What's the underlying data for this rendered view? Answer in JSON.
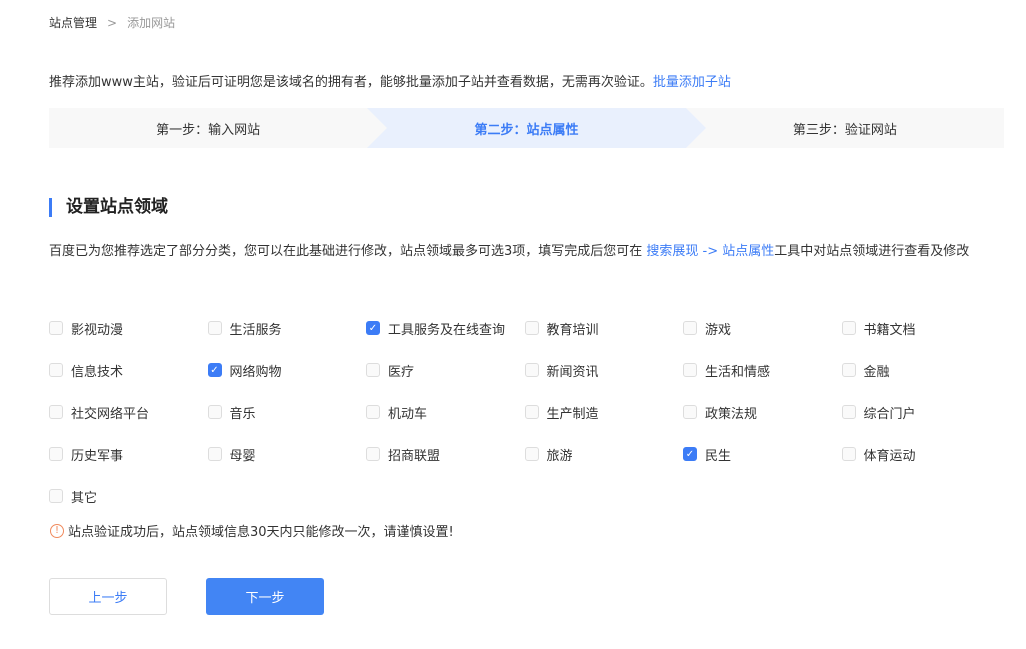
{
  "breadcrumb": {
    "parent": "站点管理",
    "separator": ">",
    "current": "添加网站"
  },
  "intro": {
    "text": "推荐添加www主站，验证后可证明您是该域名的拥有者，能够批量添加子站并查看数据，无需再次验证。",
    "link": "批量添加子站"
  },
  "steps": [
    "第一步：输入网站",
    "第二步：站点属性",
    "第三步：验证网站"
  ],
  "section": {
    "title": "设置站点领域",
    "desc_1": "百度已为您推荐选定了部分分类，您可以在此基础进行修改，站点领域最多可选3项，填写完成后您可在 ",
    "link_1": "搜索展现 -> 站点属性",
    "desc_2": "工具中对站点领域进行查看及修改"
  },
  "categories": [
    {
      "label": "影视动漫",
      "checked": false
    },
    {
      "label": "生活服务",
      "checked": false
    },
    {
      "label": "工具服务及在线查询",
      "checked": true
    },
    {
      "label": "教育培训",
      "checked": false
    },
    {
      "label": "游戏",
      "checked": false
    },
    {
      "label": "书籍文档",
      "checked": false
    },
    {
      "label": "信息技术",
      "checked": false
    },
    {
      "label": "网络购物",
      "checked": true
    },
    {
      "label": "医疗",
      "checked": false
    },
    {
      "label": "新闻资讯",
      "checked": false
    },
    {
      "label": "生活和情感",
      "checked": false
    },
    {
      "label": "金融",
      "checked": false
    },
    {
      "label": "社交网络平台",
      "checked": false
    },
    {
      "label": "音乐",
      "checked": false
    },
    {
      "label": "机动车",
      "checked": false
    },
    {
      "label": "生产制造",
      "checked": false
    },
    {
      "label": "政策法规",
      "checked": false
    },
    {
      "label": "综合门户",
      "checked": false
    },
    {
      "label": "历史军事",
      "checked": false
    },
    {
      "label": "母婴",
      "checked": false
    },
    {
      "label": "招商联盟",
      "checked": false
    },
    {
      "label": "旅游",
      "checked": false
    },
    {
      "label": "民生",
      "checked": true
    },
    {
      "label": "体育运动",
      "checked": false
    },
    {
      "label": "其它",
      "checked": false
    }
  ],
  "warning": "站点验证成功后，站点领域信息30天内只能修改一次，请谨慎设置!",
  "buttons": {
    "prev": "上一步",
    "next": "下一步"
  }
}
